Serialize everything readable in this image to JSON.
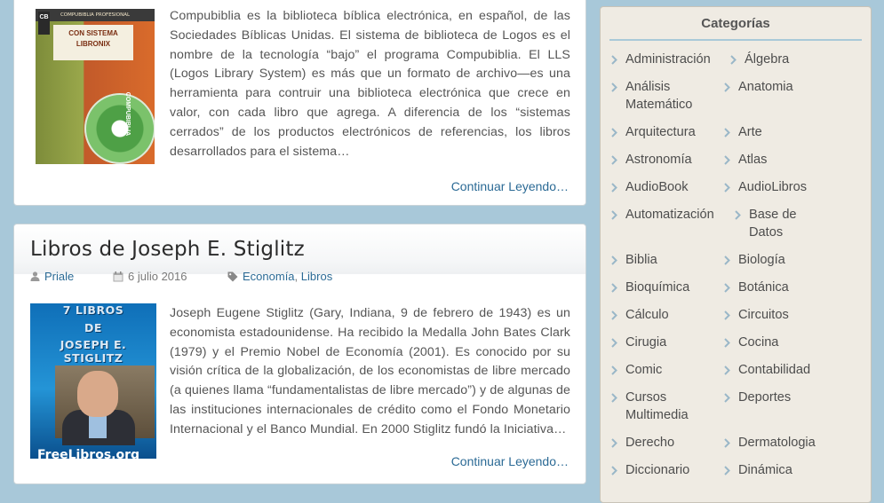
{
  "post1": {
    "excerpt": "Compubiblia es la biblioteca bíblica electrónica, en español, de las Sociedades Bíblicas Unidas. El sistema de biblioteca de Logos es el nombre de la tecnología “bajo” el programa Compubiblia. El LLS (Logos Library System) es más que un formato de archivo—es una herramienta para contruir una biblioteca electrónica que crece en valor, con cada libro que agrega. A diferencia de los “sistemas cerrados” de los productos electrónicos de referencias, los libros desarrollados para el sistema…",
    "read_more": "Continuar Leyendo…",
    "cover": {
      "band": "COMPUBIBLIA PROFESIONAL",
      "title_line1": "CON SISTEMA",
      "title_line2": "LIBRONIX",
      "logo": "CB",
      "disc_text": "COMPUBIBLIA"
    }
  },
  "post2": {
    "title": "Libros de Joseph E. Stiglitz",
    "author": "Priale",
    "date": "6 julio 2016",
    "categories": [
      "Economía",
      "Libros"
    ],
    "category_sep": ",",
    "excerpt": "Joseph Eugene Stiglitz (Gary, Indiana, 9 de febrero de 1943) es un economista estadounidense. Ha recibido la Medalla John Bates Clark (1979) y el Premio Nobel de Economía (2001). Es conocido por su visión crítica de la globalización, de los economistas de libre mercado (a quienes llama “fundamentalistas de libre mercado”) y de algunas de las instituciones internacionales de crédito como el Fondo Monetario Internacional y el Banco Mundial. En 2000 Stiglitz fundó la Iniciativa…",
    "read_more": "Continuar Leyendo…",
    "cover": {
      "line1": "7 LIBROS",
      "line2": "DE",
      "line3": "JOSEPH E. STIGLITZ",
      "brand": "FreeLibros.org"
    }
  },
  "sidebar": {
    "title": "Categorías",
    "categories": [
      [
        "Administración"
      ],
      [
        "Álgebra"
      ],
      [
        "Análisis",
        "Matemático"
      ],
      [
        "Anatomia"
      ],
      [
        "Arquitectura"
      ],
      [
        "Arte"
      ],
      [
        "Astronomía"
      ],
      [
        "Atlas"
      ],
      [
        "AudioBook"
      ],
      [
        "AudioLibros"
      ],
      [
        "Automatización"
      ],
      [
        "Base de",
        "Datos"
      ],
      [
        "Biblia"
      ],
      [
        "Biología"
      ],
      [
        "Bioquímica"
      ],
      [
        "Botánica"
      ],
      [
        "Cálculo"
      ],
      [
        "Circuitos"
      ],
      [
        "Cirugia"
      ],
      [
        "Cocina"
      ],
      [
        "Comic"
      ],
      [
        "Contabilidad"
      ],
      [
        "Cursos",
        "Multimedia"
      ],
      [
        "Deportes"
      ],
      [
        "Derecho"
      ],
      [
        "Dermatologia"
      ],
      [
        "Diccionario"
      ],
      [
        "Dinámica"
      ]
    ]
  },
  "colors": {
    "background": "#a8c8d9",
    "link": "#2b6a95",
    "sidebar_bg": "#efebe3",
    "chevron": "#9ab7c8"
  },
  "icons": {
    "author": "user-icon",
    "date": "calendar-icon",
    "categories": "tag-icon",
    "category_bullet": "chevron-right-icon"
  }
}
